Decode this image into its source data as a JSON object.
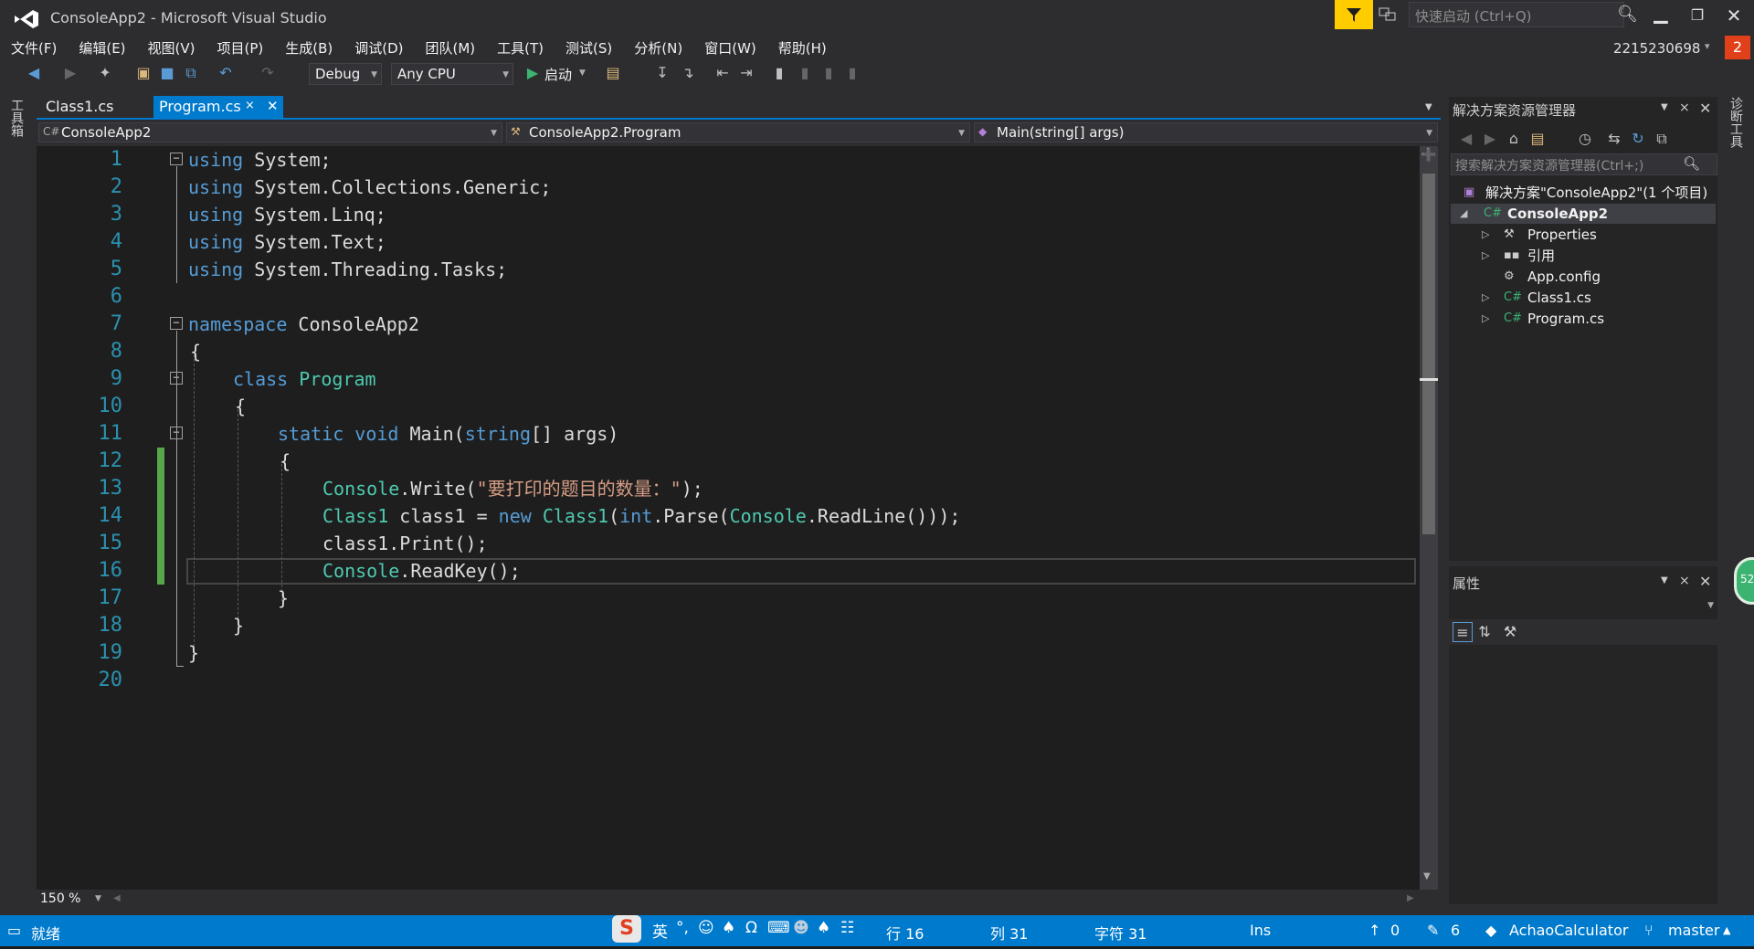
{
  "window": {
    "title": "ConsoleApp2 - Microsoft Visual Studio",
    "quick_launch_placeholder": "快速启动 (Ctrl+Q)",
    "user_name": "2215230698",
    "notification_count": "2"
  },
  "menu": [
    "文件(F)",
    "编辑(E)",
    "视图(V)",
    "项目(P)",
    "生成(B)",
    "调试(D)",
    "团队(M)",
    "工具(T)",
    "测试(S)",
    "分析(N)",
    "窗口(W)",
    "帮助(H)"
  ],
  "toolbar": {
    "config": "Debug",
    "platform": "Any CPU",
    "start_label": "启动"
  },
  "left_strip_label": "工具箱",
  "right_strip_label": "诊断工具",
  "tabs": [
    {
      "label": "Class1.cs",
      "active": false
    },
    {
      "label": "Program.cs",
      "active": true
    }
  ],
  "nav": {
    "project": "ConsoleApp2",
    "type": "ConsoleApp2.Program",
    "member": "Main(string[] args)"
  },
  "line_numbers": [
    "1",
    "2",
    "3",
    "4",
    "5",
    "6",
    "7",
    "8",
    "9",
    "10",
    "11",
    "12",
    "13",
    "14",
    "15",
    "16",
    "17",
    "18",
    "19",
    "20"
  ],
  "code": {
    "l1_kw": "using",
    "l1_rest": " System;",
    "l2_kw": "using",
    "l2_rest": " System.Collections.Generic;",
    "l3_kw": "using",
    "l3_rest": " System.Linq;",
    "l4_kw": "using",
    "l4_rest": " System.Text;",
    "l5_kw": "using",
    "l5_rest": " System.Threading.Tasks;",
    "l7_kw": "namespace",
    "l7_rest": " ConsoleApp2",
    "l8": "{",
    "l9_kw": "class",
    "l9_ty": "Program",
    "l10": "{",
    "l11_kw1": "static",
    "l11_kw2": "void",
    "l11_name": "Main(",
    "l11_kw3": "string",
    "l11_rest": "[] args)",
    "l12": "{",
    "l13_ty": "Console",
    "l13_mid": ".Write(",
    "l13_str": "\"要打印的题目的数量：\"",
    "l13_end": ");",
    "l14_ty1": "Class1",
    "l14_mid1": " class1 = ",
    "l14_kw": "new",
    "l14_ty2": "Class1",
    "l14_p": "(",
    "l14_kw2": "int",
    "l14_mid2": ".Parse(",
    "l14_ty3": "Console",
    "l14_end": ".ReadLine()));",
    "l15": "class1.Print();",
    "l16_ty": "Console",
    "l16_rest": ".ReadKey();",
    "l17": "}",
    "l18": "}",
    "l19": "}"
  },
  "zoom": "150 %",
  "solution_explorer": {
    "title": "解决方案资源管理器",
    "search_placeholder": "搜索解决方案资源管理器(Ctrl+;)",
    "solution": "解决方案\"ConsoleApp2\"(1 个项目)",
    "project": "ConsoleApp2",
    "items": [
      "Properties",
      "引用",
      "App.config",
      "Class1.cs",
      "Program.cs"
    ]
  },
  "properties": {
    "title": "属性"
  },
  "side_badge": "52",
  "status": {
    "ready": "就绪",
    "line": "行 16",
    "col": "列 31",
    "char": "字符 31",
    "ins": "Ins",
    "up_count": "0",
    "edit_count": "6",
    "repo": "AchaoCalculator",
    "branch": "master"
  },
  "ime": {
    "lang": "英",
    "punct": "°,"
  },
  "colors": {
    "accent": "#007acc",
    "keyword": "#569cd6",
    "type": "#4ec9b0",
    "string": "#d69d85",
    "line_number": "#2b91af",
    "change_marker": "#57a64a"
  }
}
